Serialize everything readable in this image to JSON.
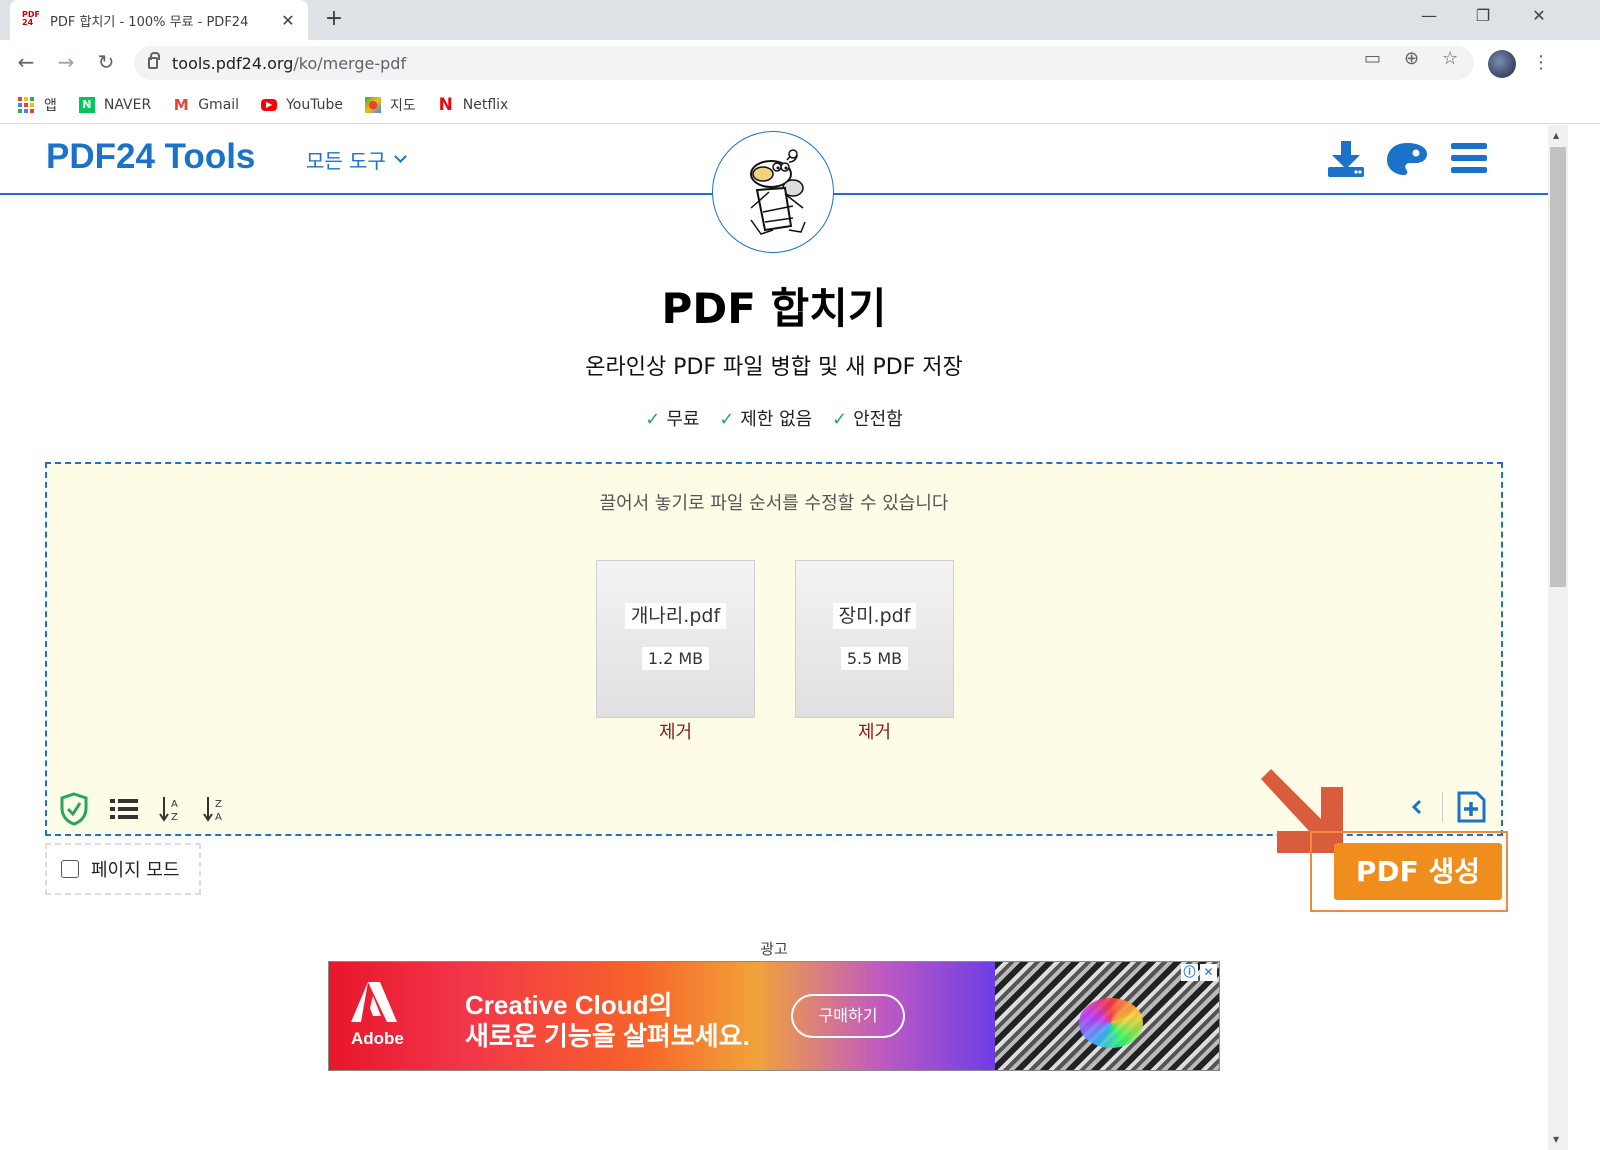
{
  "browser": {
    "tab_title": "PDF 합치기 - 100% 무료 - PDF24",
    "tab_favicon": "PDF 24",
    "url_host": "tools.pdf24.org",
    "url_path": "/ko/merge-pdf",
    "bookmarks": [
      {
        "label": "앱",
        "icon": "apps-icon"
      },
      {
        "label": "NAVER",
        "icon": "naver-icon"
      },
      {
        "label": "Gmail",
        "icon": "gmail-icon"
      },
      {
        "label": "YouTube",
        "icon": "youtube-icon"
      },
      {
        "label": "지도",
        "icon": "maps-icon"
      },
      {
        "label": "Netflix",
        "icon": "netflix-icon"
      }
    ]
  },
  "header": {
    "brand": "PDF24 Tools",
    "all_tools": "모든 도구"
  },
  "hero": {
    "title": "PDF 합치기",
    "subtitle": "온라인상 PDF 파일 병합 및 새 PDF 저장",
    "features": [
      "무료",
      "제한 없음",
      "안전함"
    ]
  },
  "dropzone": {
    "hint": "끌어서 놓기로 파일 순서를 수정할 수 있습니다",
    "files": [
      {
        "name": "개나리.pdf",
        "size": "1.2 MB",
        "remove": "제거"
      },
      {
        "name": "장미.pdf",
        "size": "5.5 MB",
        "remove": "제거"
      }
    ]
  },
  "page_mode": "페이지 모드",
  "create_button": "PDF 생성",
  "ad": {
    "label": "광고",
    "logo_text": "Adobe",
    "line1": "Creative Cloud의",
    "line2": "새로운 기능을 살펴보세요.",
    "cta": "구매하기"
  },
  "colors": {
    "brand_blue": "#1a73c9",
    "create_orange": "#ef8e1c",
    "dropzone_bg": "#fefce6",
    "remove_red": "#8b1a1a"
  }
}
